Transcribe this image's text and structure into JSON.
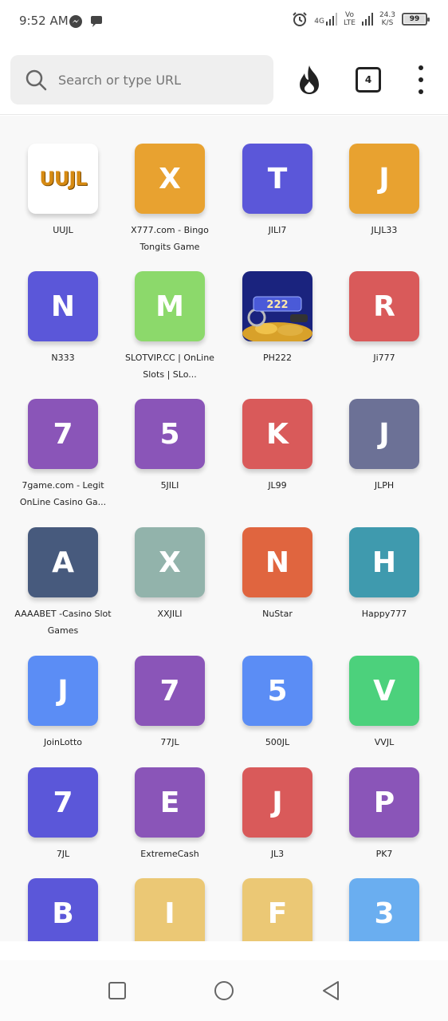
{
  "status_bar": {
    "time": "9:52 AM",
    "network_top": "4G",
    "volte_top": "Vo",
    "volte_bottom": "LTE",
    "speed_value": "24.3",
    "speed_unit": "K/S",
    "battery": "99"
  },
  "toolbar": {
    "search_placeholder": "Search or type URL",
    "tab_count": "4"
  },
  "tiles": [
    {
      "label": "UUJL",
      "letter": "",
      "color": "#ffffff",
      "image": "uujl-logo",
      "logo_text": "UUJL"
    },
    {
      "label": "X777.com - Bingo Tongits Game",
      "letter": "X",
      "color": "#e8a230"
    },
    {
      "label": "JILI7",
      "letter": "T",
      "color": "#5b57d9"
    },
    {
      "label": "JLJL33",
      "letter": "J",
      "color": "#e8a230"
    },
    {
      "label": "N333",
      "letter": "N",
      "color": "#5b57d9"
    },
    {
      "label": "SLOTVIP.CC | OnLine Slots | SLo...",
      "letter": "M",
      "color": "#8cd96b"
    },
    {
      "label": "PH222",
      "letter": "",
      "color": "#1a237e",
      "image": "ph222-banner",
      "logo_text": "PH222"
    },
    {
      "label": "Ji777",
      "letter": "R",
      "color": "#d95a5a"
    },
    {
      "label": "7game.com - Legit OnLine Casino Ga...",
      "letter": "7",
      "color": "#8a55b8"
    },
    {
      "label": "5JILI",
      "letter": "5",
      "color": "#8a55b8"
    },
    {
      "label": "JL99",
      "letter": "K",
      "color": "#d95a5a"
    },
    {
      "label": "JLPH",
      "letter": "J",
      "color": "#6c7196"
    },
    {
      "label": "AAAABET -Casino Slot Games",
      "letter": "A",
      "color": "#475a7d"
    },
    {
      "label": "XXJILI",
      "letter": "X",
      "color": "#92b3ab"
    },
    {
      "label": "NuStar",
      "letter": "N",
      "color": "#e0653f"
    },
    {
      "label": "Happy777",
      "letter": "H",
      "color": "#3f9aae"
    },
    {
      "label": "JoinLotto",
      "letter": "J",
      "color": "#5b8df5"
    },
    {
      "label": "77JL",
      "letter": "7",
      "color": "#8a55b8"
    },
    {
      "label": "500JL",
      "letter": "5",
      "color": "#5b8df5"
    },
    {
      "label": "VVJL",
      "letter": "V",
      "color": "#4cd17c"
    },
    {
      "label": "7JL",
      "letter": "7",
      "color": "#5b57d9"
    },
    {
      "label": "ExtremeCash",
      "letter": "E",
      "color": "#8a55b8"
    },
    {
      "label": "JL3",
      "letter": "J",
      "color": "#d95a5a"
    },
    {
      "label": "PK7",
      "letter": "P",
      "color": "#8a55b8"
    },
    {
      "label": "",
      "letter": "B",
      "color": "#5b57d9"
    },
    {
      "label": "",
      "letter": "I",
      "color": "#ebc875"
    },
    {
      "label": "",
      "letter": "F",
      "color": "#ebc875"
    },
    {
      "label": "",
      "letter": "3",
      "color": "#6aaef0"
    }
  ]
}
